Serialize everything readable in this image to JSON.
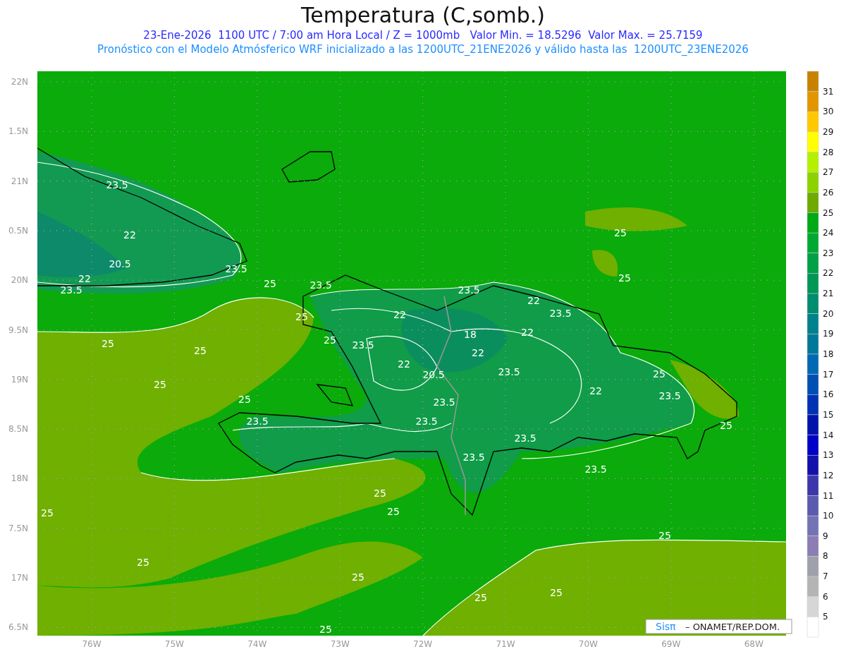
{
  "title": "Temperatura (C,somb.)",
  "subtitle": "23-Ene-2026  1100 UTC / 7:00 am Hora Local / Z = 1000mb   Valor Min. = 18.5296  Valor Max. = 25.7159",
  "description": "Pronóstico con el Modelo Atmósferico WRF inicializado a las 1200UTC_21ENE2026 y válido hasta las  1200UTC_23ENE2026",
  "map": {
    "latitude_labels": [
      "22N",
      "1.5N",
      "21N",
      "0.5N",
      "20N",
      "9.5N",
      "19N",
      "8.5N",
      "18N",
      "7.5N",
      "17N",
      "6.5N"
    ],
    "longitude_labels": [
      "76W",
      "75W",
      "74W",
      "73W",
      "72W",
      "71W",
      "70W",
      "69W",
      "68W"
    ],
    "contour_labels": [
      "23.5",
      "22",
      "20.5",
      "22",
      "23.5",
      "23.5",
      "25",
      "23.5",
      "25",
      "25",
      "25",
      "25",
      "23.5",
      "22",
      "22",
      "20.5",
      "18",
      "22",
      "22",
      "23.5",
      "22",
      "23.5",
      "23.5",
      "25",
      "25",
      "23.5",
      "23.5",
      "23.5",
      "23.5",
      "23.5",
      "22",
      "25",
      "23.5",
      "25",
      "25",
      "25",
      "23.5",
      "25",
      "25",
      "25",
      "25",
      "25",
      "25",
      "25",
      "25",
      "25"
    ]
  },
  "colorbar": [
    {
      "color": "#c88200"
    },
    {
      "color": "#e19600",
      "label": "31"
    },
    {
      "color": "#ffc800",
      "label": "30"
    },
    {
      "color": "#ffff00",
      "label": "29"
    },
    {
      "color": "#b4f000",
      "label": "28"
    },
    {
      "color": "#8cd200",
      "label": "27"
    },
    {
      "color": "#6eaa00",
      "label": "26"
    },
    {
      "color": "#00aa14",
      "label": "25"
    },
    {
      "color": "#00aa32",
      "label": "24"
    },
    {
      "color": "#00a046",
      "label": "23"
    },
    {
      "color": "#009655",
      "label": "22"
    },
    {
      "color": "#008c6e",
      "label": "21"
    },
    {
      "color": "#00828c",
      "label": "20"
    },
    {
      "color": "#00789b",
      "label": "19"
    },
    {
      "color": "#0069b4",
      "label": "18"
    },
    {
      "color": "#0050b4",
      "label": "17"
    },
    {
      "color": "#0032b4",
      "label": "16"
    },
    {
      "color": "#0014aa",
      "label": "15"
    },
    {
      "color": "#0000c8",
      "label": "14"
    },
    {
      "color": "#1410aa",
      "label": "13"
    },
    {
      "color": "#3c37aa",
      "label": "12"
    },
    {
      "color": "#5a5aaf",
      "label": "11"
    },
    {
      "color": "#7373b4",
      "label": "10"
    },
    {
      "color": "#8c7db4",
      "label": "9"
    },
    {
      "color": "#a0a0aa",
      "label": "8"
    },
    {
      "color": "#b4b4b4",
      "label": "7"
    },
    {
      "color": "#d6d6d6",
      "label": "6"
    },
    {
      "color": "#ffffff",
      "label": "5"
    }
  ],
  "credit": {
    "logo": "Sisπ",
    "text": "– ONAMET/REP.DOM."
  }
}
